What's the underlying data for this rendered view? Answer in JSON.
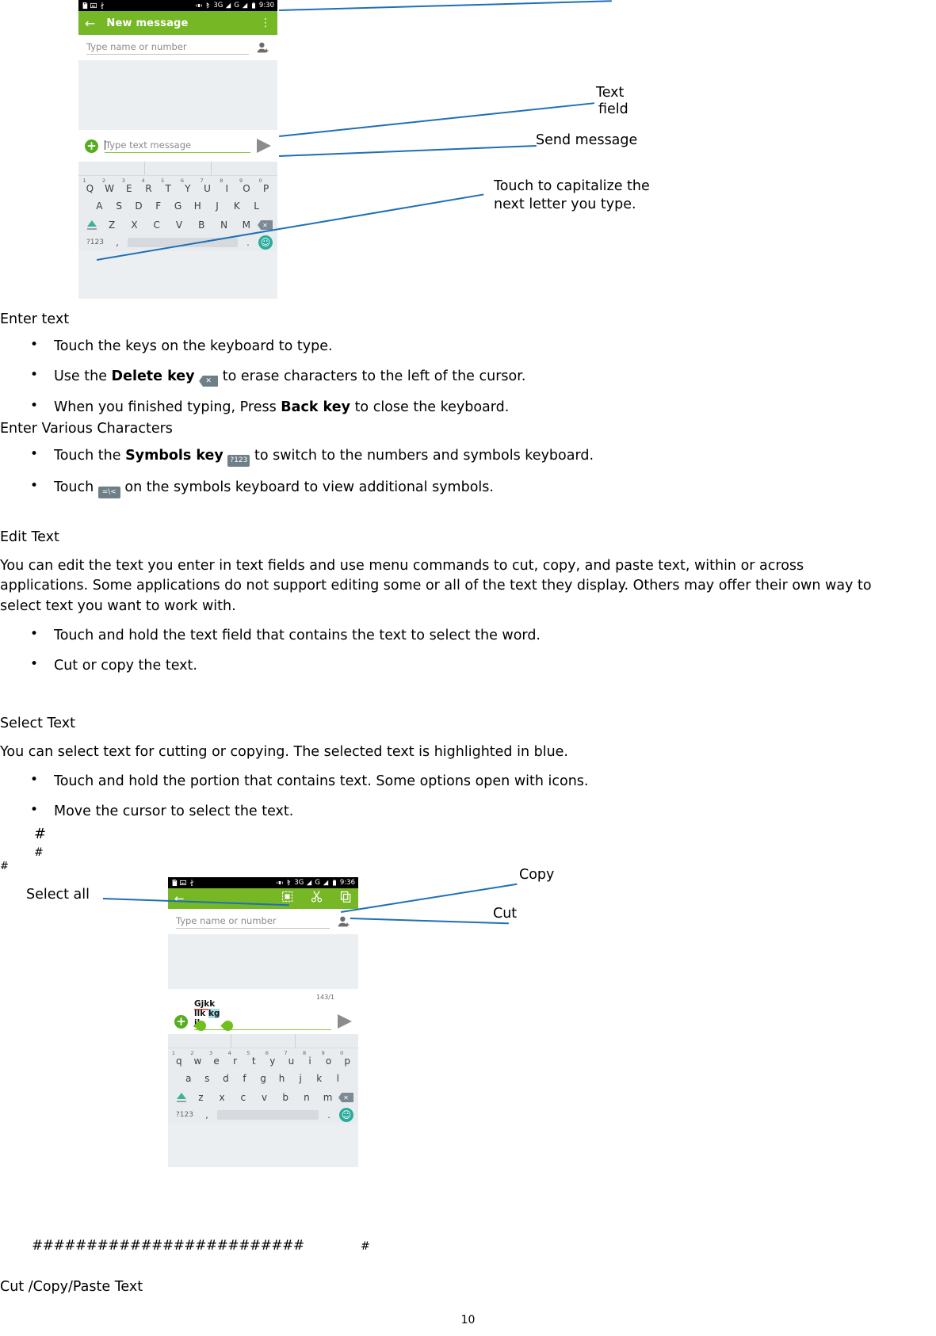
{
  "phone1": {
    "status_bar": {
      "icons": [
        "sd-card-icon",
        "image-icon",
        "usb-icon",
        "vibrate-icon",
        "bluetooth-icon"
      ],
      "network1": "3G",
      "network2": "G",
      "time": "9:30"
    },
    "appbar": {
      "back": "←",
      "title": "New message",
      "overflow": "⋮"
    },
    "recipient_placeholder": "Type name or number",
    "composer_placeholder": "Type text message",
    "keyboard": {
      "row1": [
        {
          "k": "Q",
          "n": "1"
        },
        {
          "k": "W",
          "n": "2"
        },
        {
          "k": "E",
          "n": "3"
        },
        {
          "k": "R",
          "n": "4"
        },
        {
          "k": "T",
          "n": "5"
        },
        {
          "k": "Y",
          "n": "6"
        },
        {
          "k": "U",
          "n": "7"
        },
        {
          "k": "I",
          "n": "8"
        },
        {
          "k": "O",
          "n": "9"
        },
        {
          "k": "P",
          "n": "0"
        }
      ],
      "row2": [
        "A",
        "S",
        "D",
        "F",
        "G",
        "H",
        "J",
        "K",
        "L"
      ],
      "row3": [
        "Z",
        "X",
        "C",
        "V",
        "B",
        "N",
        "M"
      ],
      "sym_key": "?123",
      "comma": ",",
      "period": ".",
      "emoji": "☺"
    }
  },
  "phone2": {
    "status_bar": {
      "network1": "3G",
      "network2": "G",
      "time": "9:36"
    },
    "toolbar": {
      "back": "←",
      "select_all": "select-all-icon",
      "cut": "cut-icon",
      "copy": "copy-icon"
    },
    "recipient_placeholder": "Type name or number",
    "message_line1": "Gjkk",
    "message_line2a": "llk ",
    "message_line2b": "kg",
    "message_line3": "jh",
    "counter": "143/1",
    "keyboard": {
      "row1": [
        {
          "k": "q",
          "n": "1"
        },
        {
          "k": "w",
          "n": "2"
        },
        {
          "k": "e",
          "n": "3"
        },
        {
          "k": "r",
          "n": "4"
        },
        {
          "k": "t",
          "n": "5"
        },
        {
          "k": "y",
          "n": "6"
        },
        {
          "k": "u",
          "n": "7"
        },
        {
          "k": "i",
          "n": "8"
        },
        {
          "k": "o",
          "n": "9"
        },
        {
          "k": "p",
          "n": "0"
        }
      ],
      "row2": [
        "a",
        "s",
        "d",
        "f",
        "g",
        "h",
        "j",
        "k",
        "l"
      ],
      "row3": [
        "z",
        "x",
        "c",
        "v",
        "b",
        "n",
        "m"
      ],
      "sym_key": "?123",
      "comma": ",",
      "period": ".",
      "emoji": "☺"
    }
  },
  "callouts": {
    "text_field_l1": "Text",
    "text_field_l2": "field",
    "send_message": "Send message",
    "capitalize_l1": "Touch   to   capitalize   the",
    "capitalize_l2": "next letter you type.",
    "select_all": "Select all",
    "copy": "Copy",
    "cut": "Cut"
  },
  "document": {
    "enter_text_heading": "Enter text",
    "enter_text_bullets": [
      {
        "pre": "Touch the keys on the keyboard to type.",
        "bold": "",
        "post": "",
        "icon": ""
      },
      {
        "pre": "Use the ",
        "bold": "Delete key",
        "post": " to erase characters to the left of the cursor.",
        "icon": "delete-key-icon"
      },
      {
        "pre": "When you finished typing, Press ",
        "bold": "Back key",
        "post": " to close the keyboard.",
        "icon": ""
      }
    ],
    "various_heading": "Enter Various Characters",
    "various_bullets": [
      {
        "pre": "Touch the ",
        "bold": "Symbols key",
        "post": " to switch to the numbers and symbols keyboard.",
        "icon": "?123"
      },
      {
        "pre": "Touch ",
        "bold": "",
        "post": " on the symbols keyboard to view additional symbols.",
        "icon": "=\\<"
      }
    ],
    "edit_text_heading": "Edit Text",
    "edit_text_para": "You can edit the text you enter in text fields and use menu commands to cut, copy, and paste text, within or across applications. Some applications do not support editing some or all of the text they display. Others may offer their own way to select text you want to work with.",
    "edit_text_bullets": [
      "Touch and hold the text field that contains the text to select the word.",
      "Cut or copy the text."
    ],
    "select_text_heading": "Select Text",
    "select_text_para": "You can select text for cutting or copying. The selected text is highlighted in blue.",
    "select_text_bullets": [
      "Touch and hold the portion that contains text. Some options open with icons.",
      "Move the cursor to select the text."
    ],
    "hash1": "#",
    "hash2": "#",
    "hash3": "#",
    "hash_row": "#########################",
    "hash_tail": "#",
    "footer_heading": "Cut /Copy/Paste Text",
    "page_number": "10"
  }
}
